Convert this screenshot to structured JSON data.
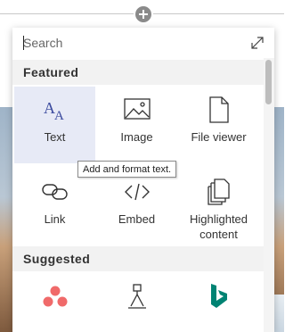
{
  "search": {
    "placeholder": "Search"
  },
  "sections": {
    "featured": "Featured",
    "suggested": "Suggested"
  },
  "featured_tiles": [
    {
      "label": "Text",
      "icon": "text-icon",
      "selected": true
    },
    {
      "label": "Image",
      "icon": "image-icon"
    },
    {
      "label": "File viewer",
      "icon": "file-icon"
    },
    {
      "label": "Link",
      "icon": "link-icon"
    },
    {
      "label": "Embed",
      "icon": "embed-icon"
    },
    {
      "label": "Highlighted\ncontent",
      "icon": "highlighted-content-icon"
    }
  ],
  "suggested_tiles": [
    {
      "icon": "asana-icon",
      "color": "#f06a6a"
    },
    {
      "icon": "planner-icon"
    },
    {
      "icon": "bing-icon",
      "color": "#008373"
    }
  ],
  "tooltip": "Add and format text.",
  "colors": {
    "accent": "#5b6fbf",
    "selected_bg": "#e7eaf6",
    "header_bg": "#f2f2f2"
  }
}
